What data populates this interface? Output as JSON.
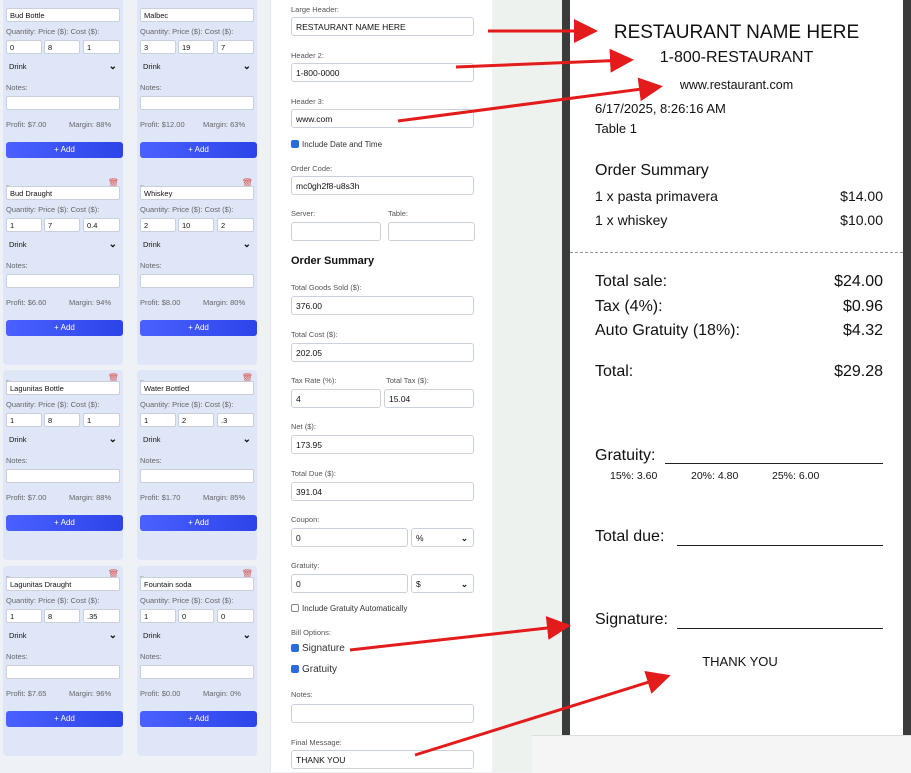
{
  "labels": {
    "item": "Item:",
    "qpc": "Quantity: Price ($): Cost ($):",
    "notes": "Notes:",
    "add": "+ Add",
    "profit": "Profit:",
    "margin": "Margin:"
  },
  "cards": [
    {
      "name": "Bud Bottle",
      "qty": "0",
      "price": "8",
      "cost": "1",
      "type": "Drink",
      "profit": "$7.00",
      "margin": "88%"
    },
    {
      "name": "Malbec",
      "qty": "3",
      "price": "19",
      "cost": "7",
      "type": "Drink",
      "profit": "$12.00",
      "margin": "63%"
    },
    {
      "name": "Bud Draught",
      "qty": "1",
      "price": "7",
      "cost": "0.4",
      "type": "Drink",
      "profit": "$6.60",
      "margin": "94%"
    },
    {
      "name": "Whiskey",
      "qty": "2",
      "price": "10",
      "cost": "2",
      "type": "Drink",
      "profit": "$8.00",
      "margin": "80%"
    },
    {
      "name": "Lagunitas Bottle",
      "qty": "1",
      "price": "8",
      "cost": "1",
      "type": "Drink",
      "profit": "$7.00",
      "margin": "88%"
    },
    {
      "name": "Water Bottled",
      "qty": "1",
      "price": "2",
      "cost": ".3",
      "type": "Drink",
      "profit": "$1.70",
      "margin": "85%"
    },
    {
      "name": "Lagunitas Draught",
      "qty": "1",
      "price": "8",
      "cost": ".35",
      "type": "Drink",
      "profit": "$7.65",
      "margin": "96%"
    },
    {
      "name": "Fountain soda",
      "qty": "1",
      "price": "0",
      "cost": "0",
      "type": "Drink",
      "profit": "$0.00",
      "margin": "0%"
    }
  ],
  "form": {
    "large_header_label": "Large Header:",
    "large_header": "RESTAURANT NAME HERE",
    "header2_label": "Header 2:",
    "header2": "1-800-0000",
    "header3_label": "Header 3:",
    "header3": "www.com",
    "include_date": "Include Date and Time",
    "order_code_label": "Order Code:",
    "order_code": "mc0gh2f8-u8s3h",
    "server_label": "Server:",
    "table_label": "Table:",
    "order_summary": "Order Summary",
    "total_goods_label": "Total Goods Sold ($):",
    "total_goods": "376.00",
    "total_cost_label": "Total Cost ($):",
    "total_cost": "202.05",
    "tax_rate_label": "Tax Rate (%):",
    "tax_rate": "4",
    "total_tax_label": "Total Tax ($):",
    "total_tax": "15.04",
    "net_label": "Net ($):",
    "net": "173.95",
    "total_due_label": "Total Due ($):",
    "total_due": "391.04",
    "coupon_label": "Coupon:",
    "coupon": "0",
    "coupon_unit": "%",
    "gratuity_label": "Gratuity:",
    "gratuity": "0",
    "gratuity_unit": "$",
    "include_gratuity": "Include Gratuity Automatically",
    "bill_options_label": "Bill Options:",
    "opt_signature": "Signature",
    "opt_gratuity": "Gratuity",
    "notes_label": "Notes:",
    "final_message_label": "Final Message:",
    "final_message": "THANK YOU"
  },
  "receipt": {
    "title": "RESTAURANT NAME HERE",
    "phone": "1-800-RESTAURANT",
    "web": "www.restaurant.com",
    "datetime": "6/17/2025, 8:26:16 AM",
    "table": "Table 1",
    "summary_title": "Order Summary",
    "items": [
      {
        "desc": "1 x pasta primavera",
        "price": "$14.00"
      },
      {
        "desc": "1 x whiskey",
        "price": "$10.00"
      }
    ],
    "total_sale_label": "Total sale:",
    "total_sale": "$24.00",
    "tax_label": "Tax (4%):",
    "tax": "$0.96",
    "auto_grat_label": "Auto Gratuity (18%):",
    "auto_grat": "$4.32",
    "total_label": "Total:",
    "total": "$29.28",
    "gratuity_label": "Gratuity:",
    "tip15": "15%: 3.60",
    "tip20": "20%: 4.80",
    "tip25": "25%: 6.00",
    "total_due_label": "Total due:",
    "signature_label": "Signature:",
    "thanks": "THANK YOU"
  },
  "colors": {
    "accent": "#2d44e8",
    "arrow": "#e31b1b",
    "card_bg": "#dfe6f8",
    "trash": "#d9534f"
  }
}
